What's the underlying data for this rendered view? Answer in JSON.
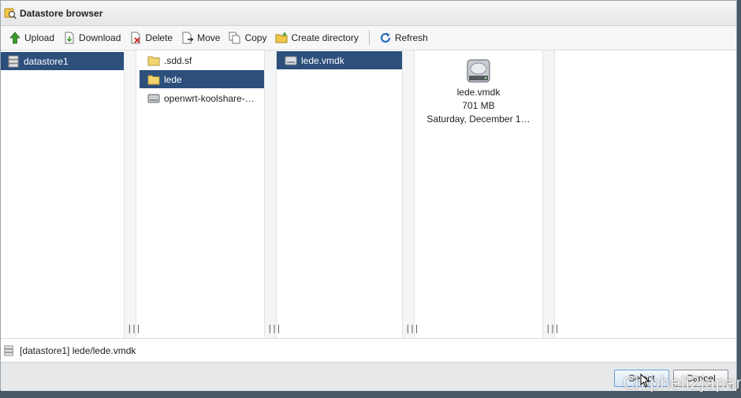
{
  "window": {
    "title": "Datastore browser"
  },
  "toolbar": {
    "upload": "Upload",
    "download": "Download",
    "delete": "Delete",
    "move": "Move",
    "copy": "Copy",
    "create_directory": "Create directory",
    "refresh": "Refresh"
  },
  "panes": {
    "datastores": [
      {
        "label": "datastore1",
        "icon": "datastore-icon",
        "selected": true
      }
    ],
    "folders": [
      {
        "label": ".sdd.sf",
        "icon": "folder-icon",
        "selected": false
      },
      {
        "label": "lede",
        "icon": "folder-icon",
        "selected": true
      },
      {
        "label": "openwrt-koolshare-…",
        "icon": "disk-icon",
        "selected": false
      }
    ],
    "files": [
      {
        "label": "lede.vmdk",
        "icon": "disk-icon",
        "selected": true
      }
    ],
    "details": {
      "icon": "hard-disk-icon",
      "name": "lede.vmdk",
      "size": "701 MB",
      "date": "Saturday, December 1…"
    }
  },
  "path": {
    "value": "[datastore1] lede/lede.vmdk"
  },
  "buttons": {
    "select": "Select",
    "cancel": "Cancel"
  },
  "watermark": "Chiphell2japan",
  "colors": {
    "selection": "#2c4f7c",
    "background": "#4a5966"
  }
}
